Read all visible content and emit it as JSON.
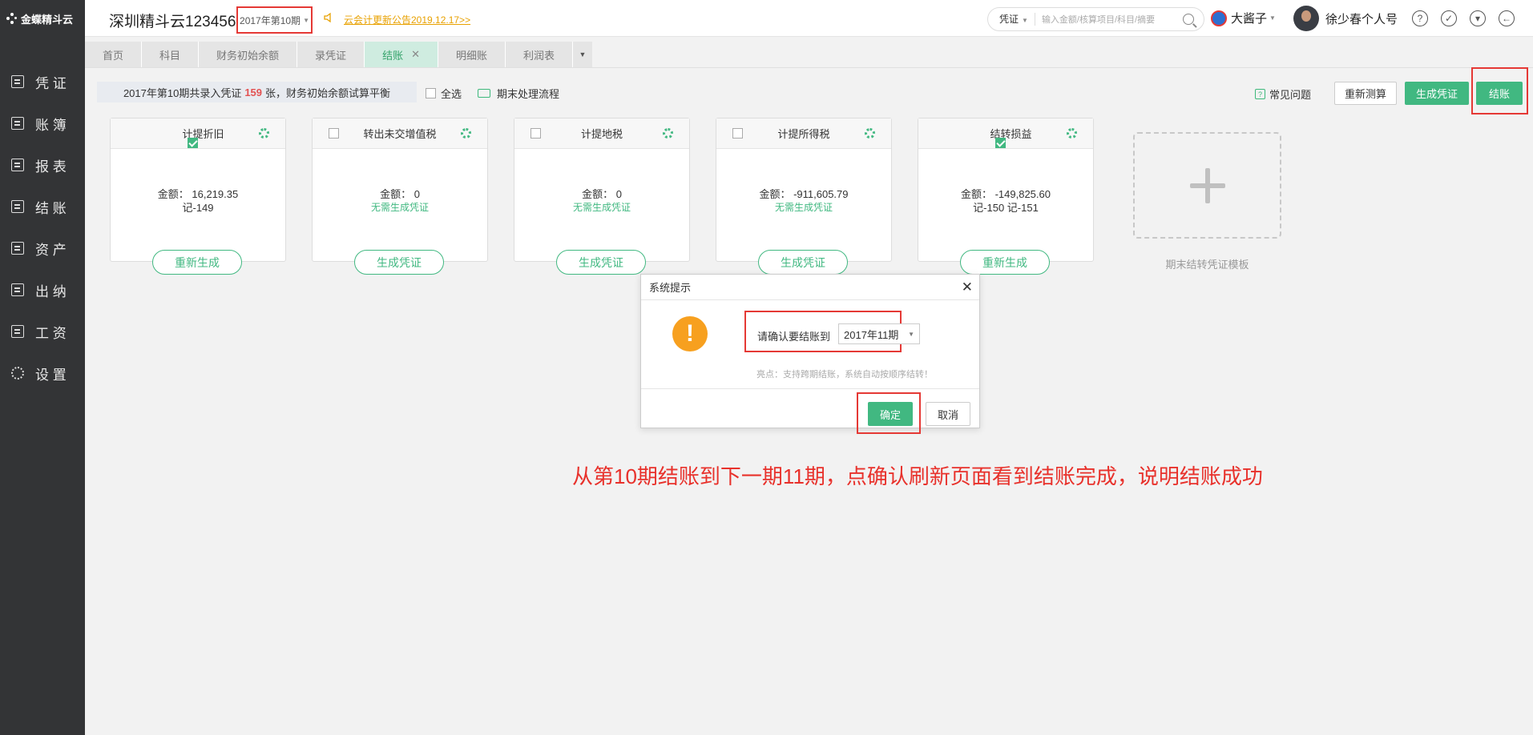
{
  "app": {
    "logo_text": "金蝶精斗云"
  },
  "sidebar": {
    "items": [
      {
        "label": "凭 证",
        "icon": "voucher-icon"
      },
      {
        "label": "账 簿",
        "icon": "ledger-icon"
      },
      {
        "label": "报 表",
        "icon": "report-icon"
      },
      {
        "label": "结 账",
        "icon": "closing-icon"
      },
      {
        "label": "资 产",
        "icon": "asset-icon"
      },
      {
        "label": "出 纳",
        "icon": "cashier-icon"
      },
      {
        "label": "工 资",
        "icon": "salary-icon"
      },
      {
        "label": "设 置",
        "icon": "gear-icon"
      }
    ]
  },
  "header": {
    "company": "深圳精斗云123456",
    "period": "2017年第10期",
    "announcement": "云会计更新公告2019.12.17>>",
    "search_type": "凭证",
    "search_placeholder": "输入金额/核算项目/科目/摘要",
    "org_name": "大酱子",
    "user_name": "徐少春个人号",
    "icons": [
      "help-icon",
      "clock-icon",
      "shirt-icon",
      "logout-icon"
    ]
  },
  "tabs": [
    {
      "label": "首页"
    },
    {
      "label": "科目"
    },
    {
      "label": "财务初始余额"
    },
    {
      "label": "录凭证"
    },
    {
      "label": "结账",
      "active": true
    },
    {
      "label": "明细账"
    },
    {
      "label": "利润表"
    }
  ],
  "toolbar": {
    "info_prefix": "2017年第10期共录入凭证",
    "info_count": "159",
    "info_suffix": "张，财务初始余额试算平衡",
    "select_all": "全选",
    "process_flow": "期末处理流程",
    "faq": "常见问题",
    "remeasure": "重新测算",
    "generate_voucher": "生成凭证",
    "close_account": "结账"
  },
  "cards": [
    {
      "title": "计提折旧",
      "checked": true,
      "amount": "金额： 16,219.35",
      "detail": "记-149",
      "note": "",
      "button": "重新生成"
    },
    {
      "title": "转出未交增值税",
      "checked": false,
      "amount": "金额： 0",
      "detail": "",
      "note": "无需生成凭证",
      "button": "生成凭证"
    },
    {
      "title": "计提地税",
      "checked": false,
      "amount": "金额： 0",
      "detail": "",
      "note": "无需生成凭证",
      "button": "生成凭证"
    },
    {
      "title": "计提所得税",
      "checked": false,
      "amount": "金额： -911,605.79",
      "detail": "",
      "note": "无需生成凭证",
      "button": "生成凭证"
    },
    {
      "title": "结转损益",
      "checked": true,
      "amount": "金额： -149,825.60",
      "detail": "记-150 记-151",
      "note": "",
      "button": "重新生成"
    }
  ],
  "template": {
    "label": "期末结转凭证模板"
  },
  "modal": {
    "title": "系统提示",
    "confirm_label": "请确认要结账到",
    "target_period": "2017年11期",
    "tip": "亮点：支持跨期结账，系统自动按顺序结转！",
    "ok": "确定",
    "cancel": "取消"
  },
  "caption": "从第10期结账到下一期11期，点确认刷新页面看到结账完成，说明结账成功",
  "colors": {
    "accent": "#41b881",
    "highlight": "#e53935",
    "warning": "#f7a01f",
    "sidebar_bg": "#333436"
  }
}
